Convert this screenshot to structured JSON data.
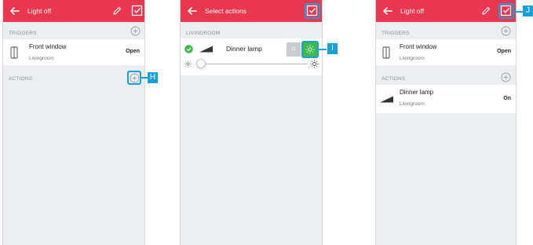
{
  "screens": [
    {
      "header_title": "Light off",
      "triggers_label": "TRIGGERS",
      "trigger": {
        "name": "Front window",
        "room": "Livingroom",
        "state": "Open"
      },
      "actions_label": "ACTIONS",
      "callout": "H"
    },
    {
      "header_title": "Select actions",
      "room_label": "LIVINGROOM",
      "device": {
        "name": "Dinner lamp",
        "off_label": "O"
      },
      "callout": "I"
    },
    {
      "header_title": "Light off",
      "triggers_label": "TRIGGERS",
      "trigger": {
        "name": "Front window",
        "room": "Livingroom",
        "state": "Open"
      },
      "actions_label": "ACTIONS",
      "action": {
        "name": "Dinner lamp",
        "room": "Livingroom",
        "state": "On"
      },
      "callout": "J"
    }
  ],
  "colors": {
    "header": "#e8374e",
    "callout": "#1aa0d8",
    "check_green": "#3cb94a",
    "panel_bg": "#eceef2"
  },
  "icons": [
    "back-arrow-icon",
    "pencil-icon",
    "checkbox-icon",
    "plus-circle-icon",
    "window-icon",
    "lamp-icon",
    "sun-icon",
    "check-circle-icon"
  ]
}
